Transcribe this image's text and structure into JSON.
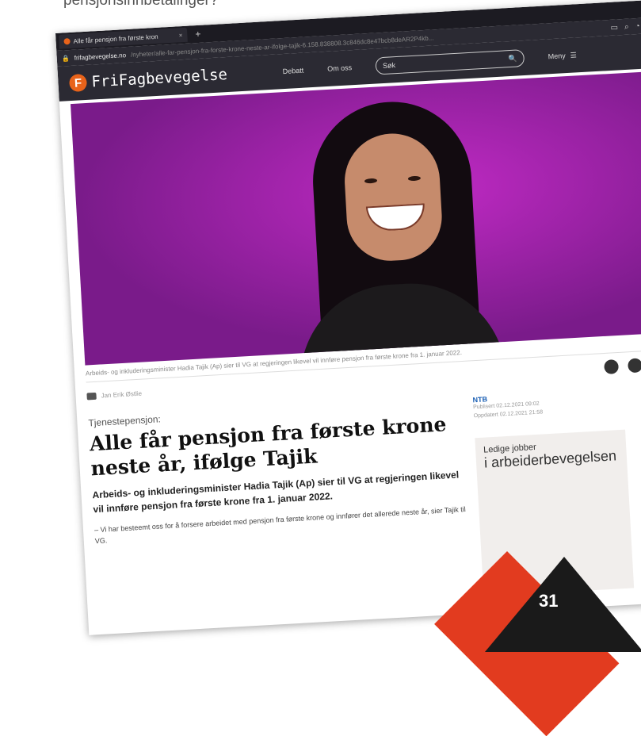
{
  "page_caption": "pensjonsinnbetalinger?",
  "browser": {
    "tab_title": "Alle får pensjon fra første kron",
    "tab_close": "×",
    "new_tab": "+",
    "url_host": "frifagbevegelse.no",
    "url_path": "/nyheter/alle-far-pensjon-fra-forste-krone-neste-ar-ifolge-tajik-6.158.838808.3c846dc8e47bcb8deAR2P4kb...",
    "icons": [
      "reader-icon",
      "zoom-icon",
      "pocket-icon",
      "bookmark-icon"
    ]
  },
  "site": {
    "logo_text": "FriFagbevegelse",
    "logo_mark": "F",
    "nav": [
      "Debatt",
      "Om oss"
    ],
    "search_placeholder": "Søk",
    "search_icon": "🔍",
    "menu_label": "Meny",
    "menu_icon": "☰"
  },
  "article": {
    "image_caption": "Arbeids- og inkluderingsminister Hadia Tajik (Ap) sier til VG at regjeringen likevel vil innføre pensjon fra første krone fra 1. januar 2022.",
    "photo_credit": "Jan Erik Østlie",
    "kicker": "Tjenestepensjon:",
    "headline": "Alle får pensjon fra første krone neste år, ifølge Tajik",
    "lead": "Arbeids- og inkluderingsminister Hadia Tajik (Ap) sier til VG at regjeringen likevel vil innføre pensjon fra første krone fra 1. januar 2022.",
    "body": "– Vi har besteemt oss for å forsere arbeidet med pensjon fra første krone og innfører det allerede neste år, sier Tajik til VG.",
    "source": "NTB",
    "published": "Publisert 02.12.2021 09:02",
    "updated": "Oppdatert 02.12.2021 21:58"
  },
  "jobs": {
    "small": "Ledige jobber",
    "big": "i arbeiderbevegelsen"
  },
  "page_number": "31"
}
